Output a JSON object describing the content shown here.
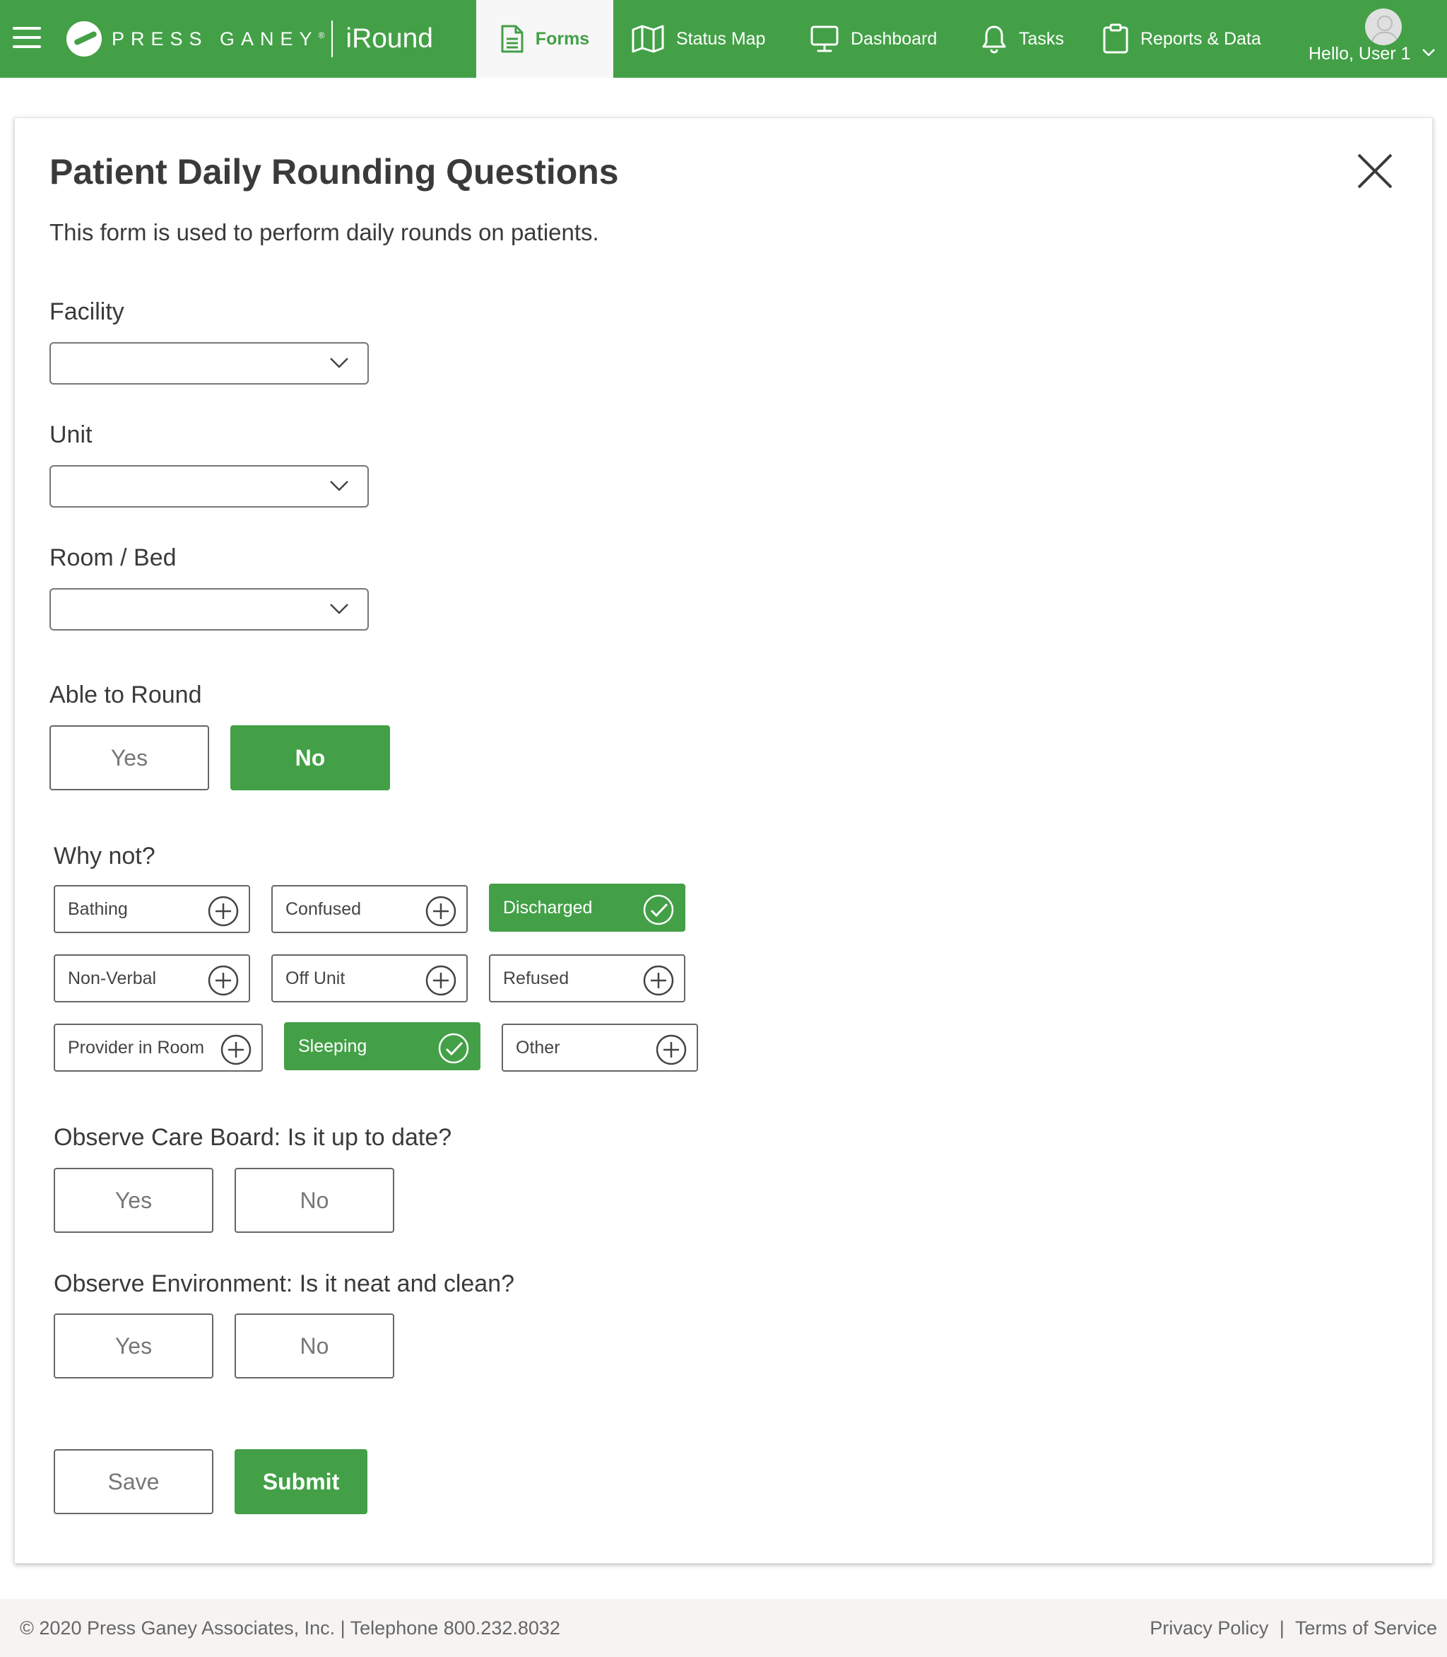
{
  "header": {
    "brand": "PRESS GANEY",
    "trademark": "®",
    "app_name": "iRound",
    "nav": [
      {
        "label": "Forms",
        "icon": "document-icon",
        "active": true
      },
      {
        "label": "Status Map",
        "icon": "map-icon",
        "active": false
      },
      {
        "label": "Dashboard",
        "icon": "monitor-icon",
        "active": false
      },
      {
        "label": "Tasks",
        "icon": "bell-icon",
        "active": false
      },
      {
        "label": "Reports & Data",
        "icon": "clipboard-icon",
        "active": false
      }
    ],
    "user_greeting": "Hello, User 1"
  },
  "form": {
    "title": "Patient Daily Rounding Questions",
    "description": "This form is used to perform daily rounds on patients.",
    "fields": {
      "facility": {
        "label": "Facility",
        "value": ""
      },
      "unit": {
        "label": "Unit",
        "value": ""
      },
      "room_bed": {
        "label": "Room / Bed",
        "value": ""
      }
    },
    "able_to_round": {
      "label": "Able to Round",
      "yes": "Yes",
      "no": "No",
      "selected": "No"
    },
    "why_not": {
      "label": "Why not?",
      "options": [
        {
          "label": "Bathing",
          "selected": false
        },
        {
          "label": "Confused",
          "selected": false
        },
        {
          "label": "Discharged",
          "selected": true
        },
        {
          "label": "Non-Verbal",
          "selected": false
        },
        {
          "label": "Off Unit",
          "selected": false
        },
        {
          "label": "Refused",
          "selected": false
        },
        {
          "label": "Provider in Room",
          "selected": false
        },
        {
          "label": "Sleeping",
          "selected": true
        },
        {
          "label": "Other",
          "selected": false
        }
      ]
    },
    "care_board": {
      "label": "Observe Care Board: Is it up to date?",
      "yes": "Yes",
      "no": "No",
      "selected": null
    },
    "environment": {
      "label": "Observe Environment: Is it neat and clean?",
      "yes": "Yes",
      "no": "No",
      "selected": null
    },
    "actions": {
      "save": "Save",
      "submit": "Submit"
    }
  },
  "footer": {
    "copyright": "© 2020 Press Ganey Associates, Inc. | Telephone 800.232.8032",
    "privacy": "Privacy Policy",
    "separator": "|",
    "terms": "Terms of Service"
  },
  "colors": {
    "brand_green": "#43a047",
    "text": "#3a3a3a"
  }
}
